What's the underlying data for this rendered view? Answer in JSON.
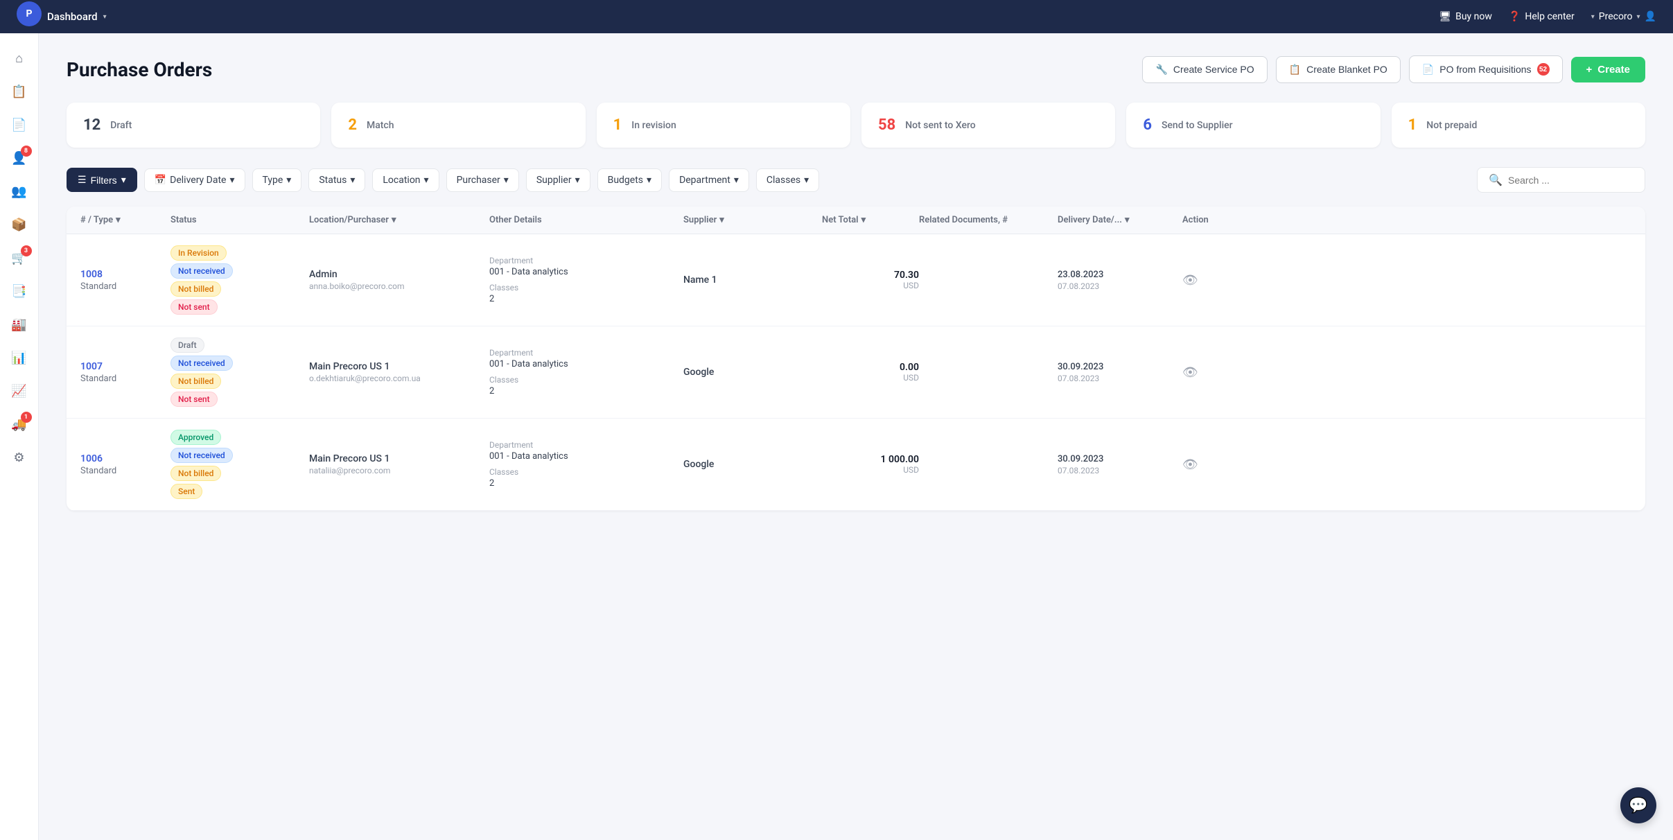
{
  "topNav": {
    "dashboard": "Dashboard",
    "buyNow": "Buy now",
    "helpCenter": "Help center",
    "account": "Precoro",
    "logoText": "P"
  },
  "page": {
    "title": "Purchase Orders",
    "actions": {
      "createServicePO": "Create Service PO",
      "createBlanketPO": "Create Blanket PO",
      "poFromRequisitions": "PO from Requisitions",
      "poFromRequisitionsBadge": "52",
      "create": "Create"
    }
  },
  "statusCards": [
    {
      "num": "12",
      "label": "Draft",
      "color": "num-gray"
    },
    {
      "num": "2",
      "label": "Match",
      "color": "num-orange"
    },
    {
      "num": "1",
      "label": "In revision",
      "color": "num-amber"
    },
    {
      "num": "58",
      "label": "Not sent to Xero",
      "color": "num-red"
    },
    {
      "num": "6",
      "label": "Send to Supplier",
      "color": "num-blue"
    },
    {
      "num": "1",
      "label": "Not prepaid",
      "color": "num-amber"
    }
  ],
  "filters": {
    "mainBtn": "Filters",
    "deliveryDate": "Delivery Date",
    "type": "Type",
    "status": "Status",
    "location": "Location",
    "purchaser": "Purchaser",
    "supplier": "Supplier",
    "budgets": "Budgets",
    "department": "Department",
    "classes": "Classes",
    "searchPlaceholder": "Search ..."
  },
  "tableHeaders": {
    "numType": "# / Type",
    "status": "Status",
    "locationPurchaser": "Location/Purchaser",
    "otherDetails": "Other Details",
    "supplier": "Supplier",
    "netTotal": "Net Total",
    "relatedDocs": "Related Documents, #",
    "deliveryDate": "Delivery Date/...",
    "action": "Action"
  },
  "rows": [
    {
      "id": "1008",
      "type": "Standard",
      "statuses": [
        {
          "label": "In Revision",
          "class": "tag-revision"
        },
        {
          "label": "Not received",
          "class": "tag-not-received"
        },
        {
          "label": "Not billed",
          "class": "tag-not-billed"
        },
        {
          "label": "Not sent",
          "class": "tag-not-sent"
        }
      ],
      "location": "Admin",
      "email": "anna.boiko@precoro.com",
      "departmentLabel": "Department",
      "department": "001 - Data analytics",
      "classesLabel": "Classes",
      "classes": "2",
      "supplier": "Name 1",
      "netTotal": "70.30",
      "currency": "USD",
      "deliveryDate": "23.08.2023",
      "createdDate": "07.08.2023"
    },
    {
      "id": "1007",
      "type": "Standard",
      "statuses": [
        {
          "label": "Draft",
          "class": "tag-draft"
        },
        {
          "label": "Not received",
          "class": "tag-not-received"
        },
        {
          "label": "Not billed",
          "class": "tag-not-billed"
        },
        {
          "label": "Not sent",
          "class": "tag-not-sent"
        }
      ],
      "location": "Main Precoro US 1",
      "email": "o.dekhtiaruk@precoro.com.ua",
      "departmentLabel": "Department",
      "department": "001 - Data analytics",
      "classesLabel": "Classes",
      "classes": "2",
      "supplier": "Google",
      "netTotal": "0.00",
      "currency": "USD",
      "deliveryDate": "30.09.2023",
      "createdDate": "07.08.2023"
    },
    {
      "id": "1006",
      "type": "Standard",
      "statuses": [
        {
          "label": "Approved",
          "class": "tag-approved"
        },
        {
          "label": "Not received",
          "class": "tag-not-received"
        },
        {
          "label": "Not billed",
          "class": "tag-not-billed"
        },
        {
          "label": "Sent",
          "class": "tag-sent"
        }
      ],
      "location": "Main Precoro US 1",
      "email": "nataliia@precoro.com",
      "departmentLabel": "Department",
      "department": "001 - Data analytics",
      "classesLabel": "Classes",
      "classes": "2",
      "supplier": "Google",
      "netTotal": "1 000.00",
      "currency": "USD",
      "deliveryDate": "30.09.2023",
      "createdDate": "07.08.2023"
    }
  ],
  "sidebar": {
    "icons": [
      {
        "name": "home-icon",
        "symbol": "⌂",
        "badge": null
      },
      {
        "name": "orders-icon",
        "symbol": "📋",
        "badge": null
      },
      {
        "name": "invoices-icon",
        "symbol": "📄",
        "badge": null
      },
      {
        "name": "suppliers-icon",
        "symbol": "👤",
        "badge": "8"
      },
      {
        "name": "contacts-icon",
        "symbol": "👥",
        "badge": null
      },
      {
        "name": "receiving-icon",
        "symbol": "📦",
        "badge": null
      },
      {
        "name": "po-icon",
        "symbol": "🛒",
        "badge": "3"
      },
      {
        "name": "catalog-icon",
        "symbol": "📑",
        "badge": null
      },
      {
        "name": "warehouses-icon",
        "symbol": "🏭",
        "badge": null
      },
      {
        "name": "reports-icon",
        "symbol": "📊",
        "badge": null
      },
      {
        "name": "analytics-icon",
        "symbol": "📈",
        "badge": null
      },
      {
        "name": "delivery-icon",
        "symbol": "🚚",
        "badge": "1"
      },
      {
        "name": "settings-icon",
        "symbol": "⚙",
        "badge": null
      }
    ]
  }
}
